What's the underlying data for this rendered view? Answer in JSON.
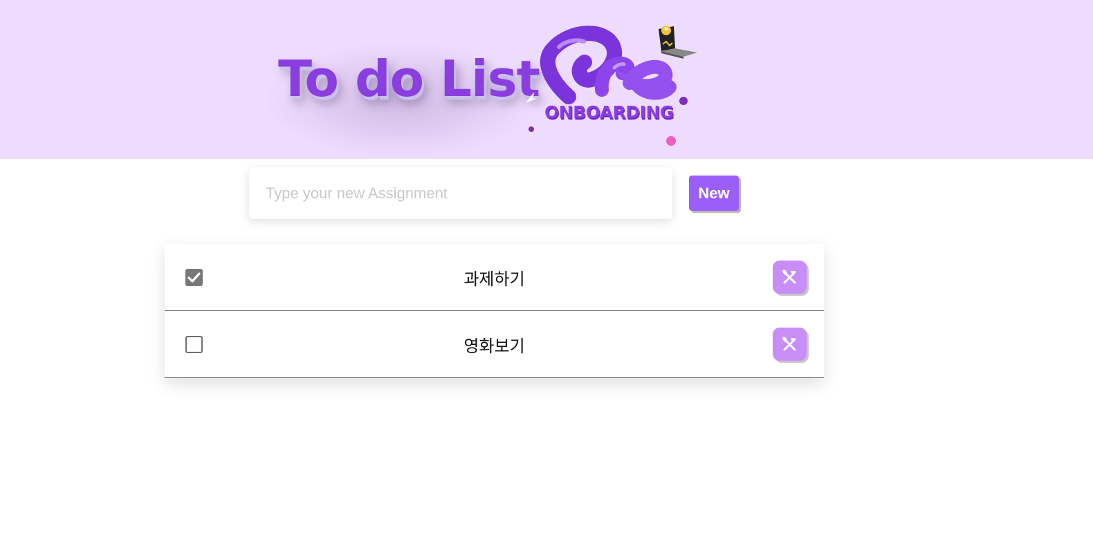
{
  "header": {
    "title": "To do List",
    "logo_text": "ONBOARDING",
    "brand_color": "#8a3ee0",
    "background_color": "#eedcfe"
  },
  "composer": {
    "placeholder": "Type your new Assignment",
    "value": "",
    "new_button_label": "New",
    "button_color": "#9b5ff7"
  },
  "todos": [
    {
      "label": "과제하기",
      "checked": true,
      "edit_icon": "tools-icon"
    },
    {
      "label": "영화보기",
      "checked": false,
      "edit_icon": "tools-icon"
    }
  ]
}
